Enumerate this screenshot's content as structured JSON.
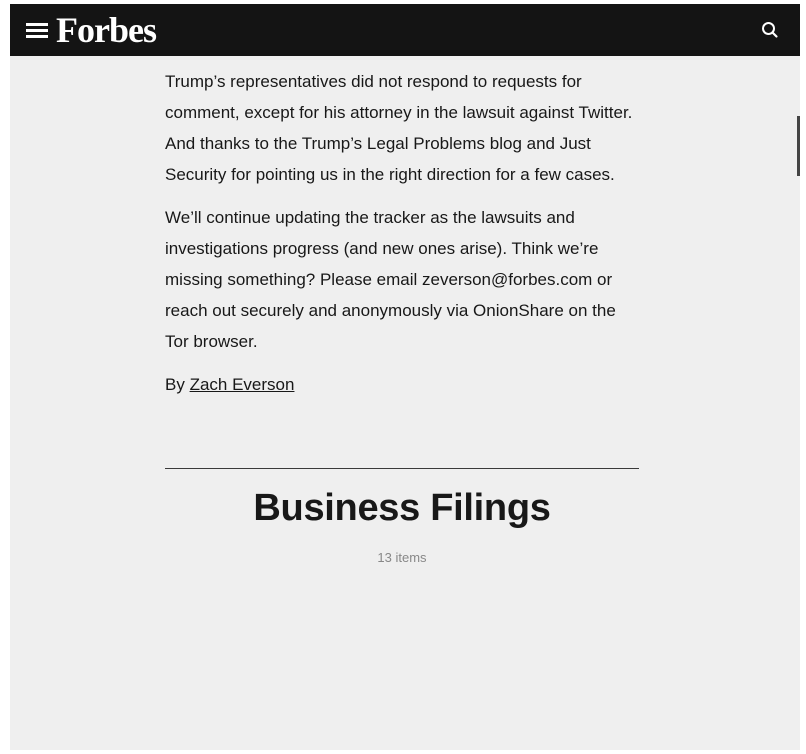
{
  "header": {
    "logo": "Forbes",
    "menu_icon": "hamburger-menu-icon",
    "search_icon": "search-icon",
    "bar_color": "#141414"
  },
  "article": {
    "paragraphs": [
      "Trump’s representatives did not respond to requests for comment, except for his attorney in the lawsuit against Twitter. And thanks to the Trump’s Legal Problems blog and Just Security for pointing us in the right direction for a few cases.",
      "We’ll continue updating the tracker as the lawsuits and investigations progress (and new ones arise). Think we’re missing something? Please email zeverson@forbes.com or reach out securely and anonymously via OnionShare on the Tor browser."
    ],
    "byline_prefix": "By",
    "author": "Zach Everson"
  },
  "section": {
    "title": "Business Filings",
    "count": "13 items"
  },
  "colors": {
    "page_background": "#efefef",
    "text": "#181818",
    "muted": "#888888"
  }
}
